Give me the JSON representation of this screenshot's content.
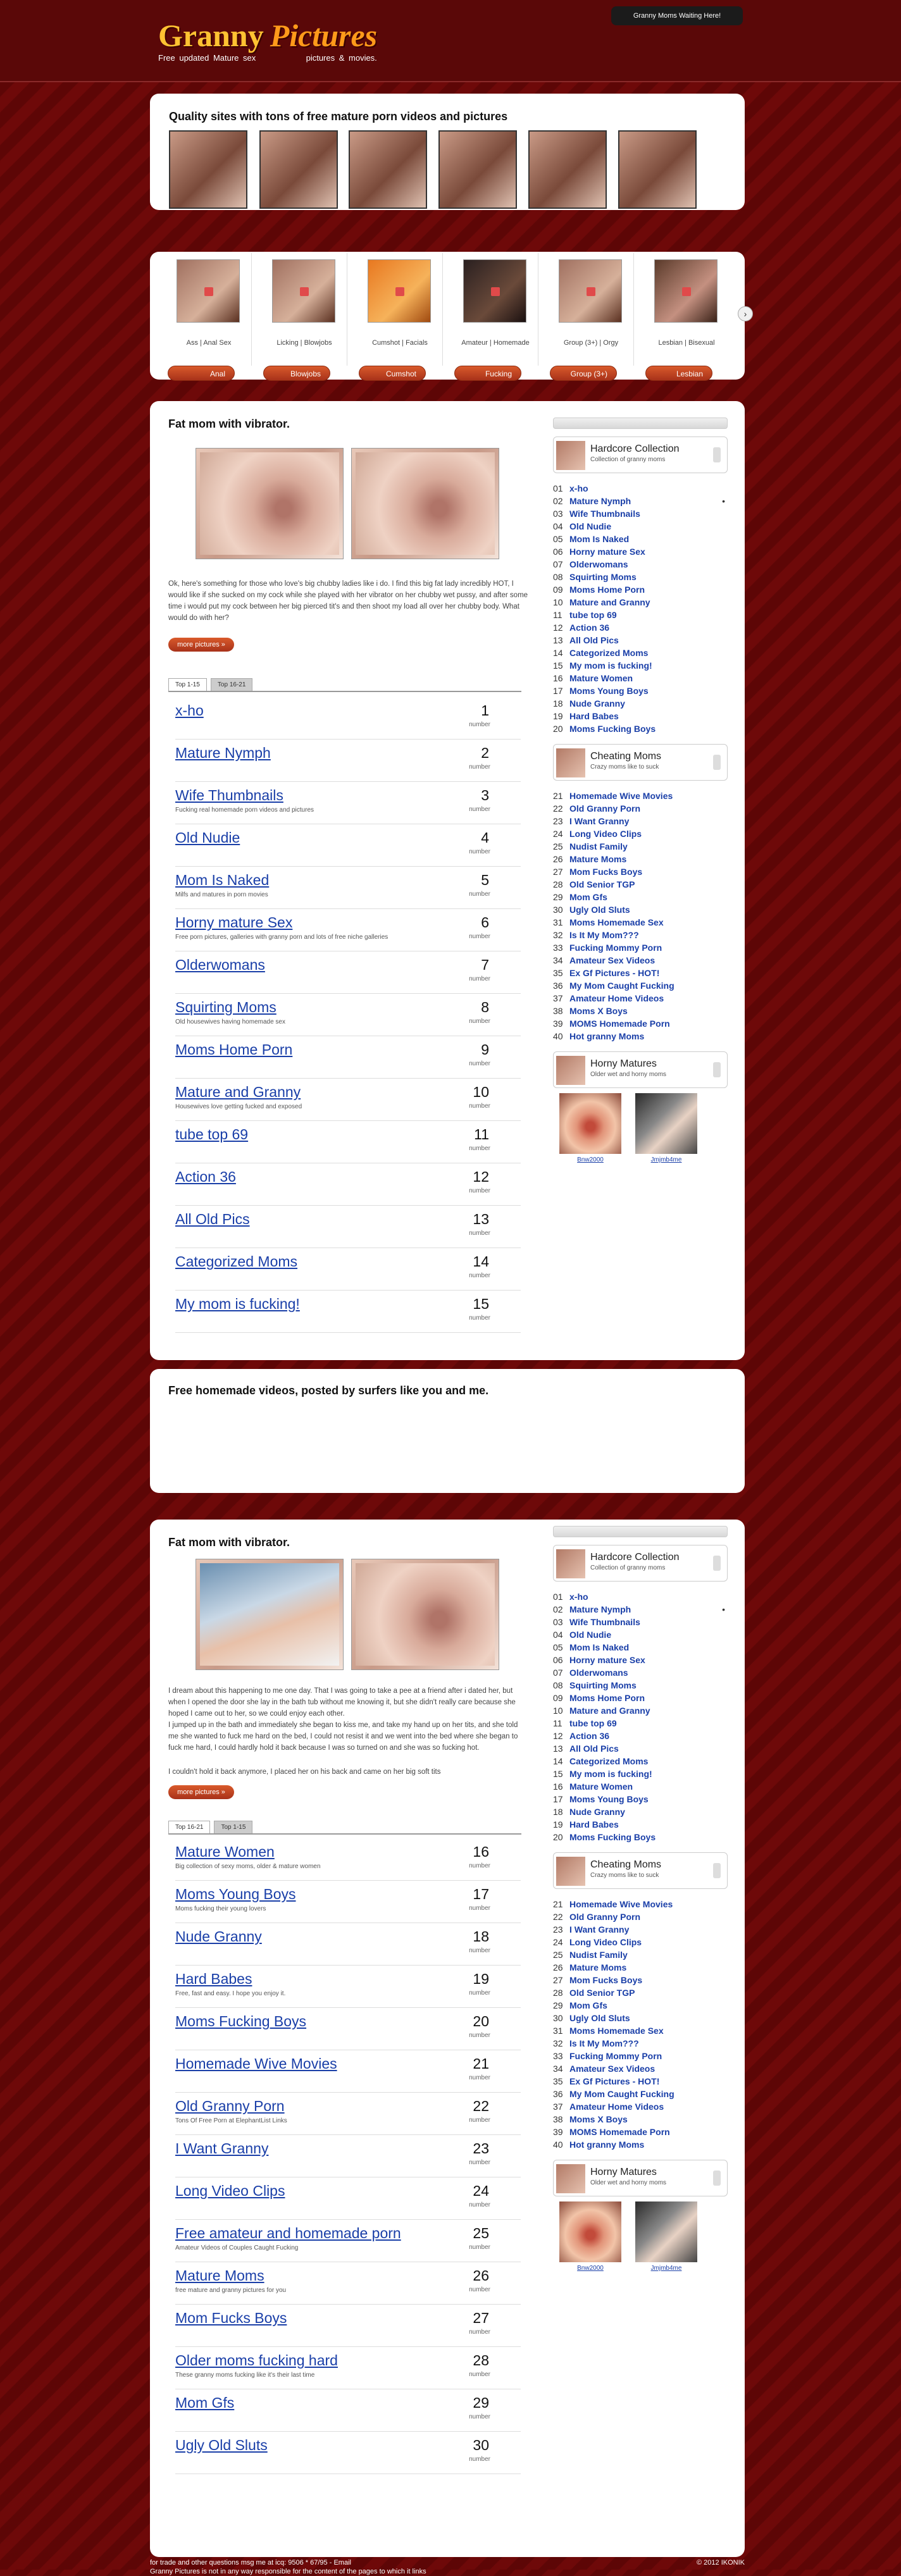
{
  "header": {
    "logo_main": "Granny",
    "logo_second": "Pictures",
    "logo_sub_left": "Free updated Mature sex",
    "logo_sub_right": "pictures & movies.",
    "badge": "Granny Moms Waiting Here!"
  },
  "quality": {
    "title": "Quality sites with tons of free mature porn videos and pictures"
  },
  "categories": [
    {
      "label": "Ass | Anal Sex",
      "button": "Anal"
    },
    {
      "label": "Licking | Blowjobs",
      "button": "Blowjobs"
    },
    {
      "label": "Cumshot | Facials",
      "button": "Cumshot"
    },
    {
      "label": "Amateur | Homemade",
      "button": "Fucking"
    },
    {
      "label": "Group (3+) | Orgy",
      "button": "Group (3+)"
    },
    {
      "label": "Lesbian | Bisexual",
      "button": "Lesbian"
    }
  ],
  "section1": {
    "title": "Fat mom with vibrator.",
    "desc": "Ok, here's something for those who love's big chubby ladies like i do. I find this big fat lady incredibly HOT, I would like if she sucked on my cock while she played with her vibrator on her chubby wet pussy, and after some time i would put my cock between her big pierced tit's and then shoot my load all over her chubby body. What would do with her?",
    "more": "more pictures »",
    "tabs": [
      "Top 1-15",
      "Top 16-21"
    ],
    "sites": [
      {
        "name": "x-ho",
        "desc": "",
        "num": "1"
      },
      {
        "name": "Mature Nymph",
        "desc": "",
        "num": "2"
      },
      {
        "name": "Wife Thumbnails",
        "desc": "Fucking real homemade porn videos and pictures",
        "num": "3"
      },
      {
        "name": "Old Nudie",
        "desc": "",
        "num": "4"
      },
      {
        "name": "Mom Is Naked",
        "desc": "Milfs and matures in porn movies",
        "num": "5"
      },
      {
        "name": "Horny mature Sex",
        "desc": "Free porn pictures, galleries with granny porn and lots of free niche galleries",
        "num": "6"
      },
      {
        "name": "Olderwomans",
        "desc": "",
        "num": "7"
      },
      {
        "name": "Squirting Moms",
        "desc": "Old housewives having homemade sex",
        "num": "8"
      },
      {
        "name": "Moms Home Porn",
        "desc": "",
        "num": "9"
      },
      {
        "name": "Mature and Granny",
        "desc": "Housewives love getting fucked and exposed",
        "num": "10"
      },
      {
        "name": "tube top 69",
        "desc": "",
        "num": "11"
      },
      {
        "name": "Action 36",
        "desc": "",
        "num": "12"
      },
      {
        "name": "All Old Pics",
        "desc": "",
        "num": "13"
      },
      {
        "name": "Categorized Moms",
        "desc": "",
        "num": "14"
      },
      {
        "name": "My mom is fucking!",
        "desc": "",
        "num": "15"
      }
    ]
  },
  "section2": {
    "title": "Fat mom with vibrator.",
    "desc1": "I dream about this happening to me one day. That I was going to take a pee at a friend after i dated her, but when I opened the door she lay in the bath tub without me knowing it, but she didn't really care because she hoped I came out to her, so we could enjoy each other.",
    "desc2": "I jumped up in the bath and immediately she began to kiss me, and take my hand up on her tits, and she told me she wanted to fuck me hard on the bed, I could not resist it and we went into the bed where she began to fuck me hard, I could hardly hold it back because I was so turned on and she was so fucking hot.",
    "desc3": "I couldn't hold it back anymore, I placed her on his back and came on her big soft tits",
    "more": "more pictures »",
    "tabs": [
      "Top 16-21",
      "Top 1-15"
    ],
    "sites": [
      {
        "name": "Mature Women",
        "desc": "Big collection of sexy moms, older & mature women",
        "num": "16"
      },
      {
        "name": "Moms Young Boys",
        "desc": "Moms fucking their young lovers",
        "num": "17"
      },
      {
        "name": "Nude Granny",
        "desc": "",
        "num": "18"
      },
      {
        "name": "Hard Babes",
        "desc": "Free, fast and easy. I hope you enjoy it.",
        "num": "19"
      },
      {
        "name": "Moms Fucking Boys",
        "desc": "",
        "num": "20"
      },
      {
        "name": "Homemade Wive Movies",
        "desc": "",
        "num": "21"
      },
      {
        "name": "Old Granny Porn",
        "desc": "Tons Of Free Porn at ElephantList Links",
        "num": "22"
      },
      {
        "name": "I Want Granny",
        "desc": "",
        "num": "23"
      },
      {
        "name": "Long Video Clips",
        "desc": "",
        "num": "24"
      },
      {
        "name": "Free amateur and homemade porn",
        "desc": "Amateur Videos of Couples Caught Fucking",
        "num": "25"
      },
      {
        "name": "Mature Moms",
        "desc": "free mature and granny pictures for you",
        "num": "26"
      },
      {
        "name": "Mom Fucks Boys",
        "desc": "",
        "num": "27"
      },
      {
        "name": "Older moms fucking hard",
        "desc": "These granny moms fucking like it's their last time",
        "num": "28"
      },
      {
        "name": "Mom Gfs",
        "desc": "",
        "num": "29"
      },
      {
        "name": "Ugly Old Sluts",
        "desc": "",
        "num": "30"
      }
    ]
  },
  "sidebar": {
    "box1": {
      "title": "Hardcore Collection",
      "sub": "Collection of granny moms"
    },
    "list1": [
      {
        "n": "01",
        "l": "x-ho"
      },
      {
        "n": "02",
        "l": "Mature Nymph"
      },
      {
        "n": "03",
        "l": "Wife Thumbnails"
      },
      {
        "n": "04",
        "l": "Old Nudie"
      },
      {
        "n": "05",
        "l": "Mom Is Naked"
      },
      {
        "n": "06",
        "l": "Horny mature Sex"
      },
      {
        "n": "07",
        "l": "Olderwomans"
      },
      {
        "n": "08",
        "l": "Squirting Moms"
      },
      {
        "n": "09",
        "l": "Moms Home Porn"
      },
      {
        "n": "10",
        "l": "Mature and Granny"
      },
      {
        "n": "11",
        "l": "tube top 69"
      },
      {
        "n": "12",
        "l": "Action 36"
      },
      {
        "n": "13",
        "l": "All Old Pics"
      },
      {
        "n": "14",
        "l": "Categorized Moms"
      },
      {
        "n": "15",
        "l": "My mom is fucking!"
      },
      {
        "n": "16",
        "l": "Mature Women"
      },
      {
        "n": "17",
        "l": "Moms Young Boys"
      },
      {
        "n": "18",
        "l": "Nude Granny"
      },
      {
        "n": "19",
        "l": "Hard Babes"
      },
      {
        "n": "20",
        "l": "Moms Fucking Boys"
      }
    ],
    "box2": {
      "title": "Cheating Moms",
      "sub": "Crazy moms like to suck"
    },
    "list2": [
      {
        "n": "21",
        "l": "Homemade Wive Movies"
      },
      {
        "n": "22",
        "l": "Old Granny Porn"
      },
      {
        "n": "23",
        "l": "I Want Granny"
      },
      {
        "n": "24",
        "l": "Long Video Clips"
      },
      {
        "n": "25",
        "l": "Nudist Family"
      },
      {
        "n": "26",
        "l": "Mature Moms"
      },
      {
        "n": "27",
        "l": "Mom Fucks Boys"
      },
      {
        "n": "28",
        "l": "Old Senior TGP"
      },
      {
        "n": "29",
        "l": "Mom Gfs"
      },
      {
        "n": "30",
        "l": "Ugly Old Sluts"
      },
      {
        "n": "31",
        "l": "Moms Homemade Sex"
      },
      {
        "n": "32",
        "l": "Is It My Mom???"
      },
      {
        "n": "33",
        "l": "Fucking Mommy Porn"
      },
      {
        "n": "34",
        "l": "Amateur Sex Videos"
      },
      {
        "n": "35",
        "l": "Ex Gf Pictures - HOT!"
      },
      {
        "n": "36",
        "l": "My Mom Caught Fucking"
      },
      {
        "n": "37",
        "l": "Amateur Home Videos"
      },
      {
        "n": "38",
        "l": "Moms X Boys"
      },
      {
        "n": "39",
        "l": "MOMS Homemade Porn"
      },
      {
        "n": "40",
        "l": "Hot granny Moms"
      }
    ],
    "box3": {
      "title": "Horny Matures",
      "sub": "Older wet and horny moms"
    },
    "thumbs": [
      "Bnw2000",
      "Jmjmb4me"
    ]
  },
  "free": {
    "title": "Free homemade videos, posted by surfers like you and me."
  },
  "footer": {
    "line1": "for trade and other questions msg me at icq: 9506 * 67/95 - Email",
    "line2": "Granny Pictures is not in any way responsible for the content of the pages to which it links",
    "copy": "© 2012 IKONIK"
  }
}
